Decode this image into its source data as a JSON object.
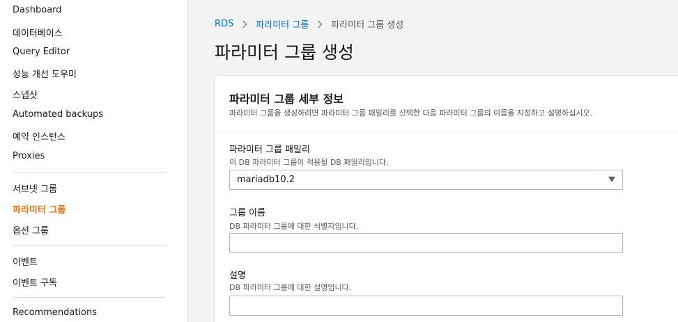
{
  "sidebar": {
    "items": [
      {
        "label": "Dashboard"
      },
      {
        "label": "데이터베이스"
      },
      {
        "label": "Query Editor"
      },
      {
        "label": "성능 개선 도우미"
      },
      {
        "label": "스냅샷"
      },
      {
        "label": "Automated backups"
      },
      {
        "label": "예약 인스턴스"
      },
      {
        "label": "Proxies"
      },
      {
        "label": "서브넷 그룹"
      },
      {
        "label": "파라미터 그룹",
        "active": true
      },
      {
        "label": "옵션 그룹"
      },
      {
        "label": "이벤트"
      },
      {
        "label": "이벤트 구독"
      },
      {
        "label": "Recommendations"
      }
    ]
  },
  "breadcrumb": {
    "items": [
      "RDS",
      "파라미터 그룹",
      "파라미터 그룹 생성"
    ]
  },
  "page": {
    "title": "파라미터 그룹 생성"
  },
  "panel": {
    "title": "파라미터 그룹 세부 정보",
    "description": "파라미터 그룹을 생성하려면 파라미터 그룹 패밀리를 선택한 다음 파라미터 그룹의 이름을 지정하고 설명하십시오.",
    "fields": {
      "family": {
        "label": "파라미터 그룹 패밀리",
        "hint": "이 DB 파라미터 그룹이 적용될 DB 패밀리입니다.",
        "value": "mariadb10.2"
      },
      "name": {
        "label": "그룹 이름",
        "hint": "DB 파라미터 그룹에 대한 식별자입니다.",
        "value": ""
      },
      "description": {
        "label": "설명",
        "hint": "DB 파라미터 그룹에 대한 설명입니다.",
        "value": ""
      }
    }
  },
  "colors": {
    "active_nav": "#ec7211",
    "link": "#0073bb",
    "background": "#f2f3f3"
  }
}
